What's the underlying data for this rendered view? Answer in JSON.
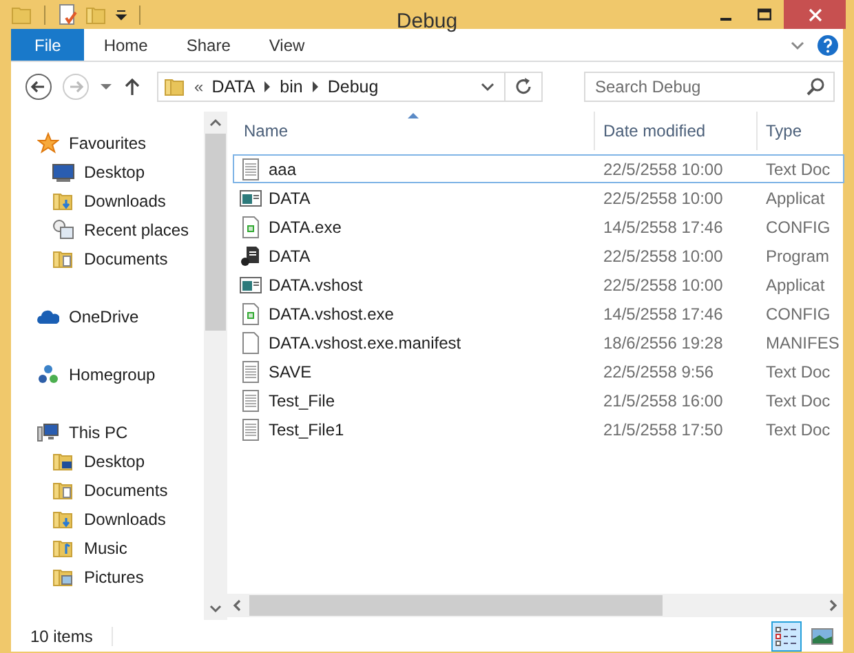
{
  "window": {
    "title": "Debug"
  },
  "ribbon_tabs": [
    {
      "label": "File",
      "kind": "file"
    },
    {
      "label": "Home",
      "kind": "tab"
    },
    {
      "label": "Share",
      "kind": "tab"
    },
    {
      "label": "View",
      "kind": "tab"
    }
  ],
  "address_bar": {
    "overflow": "«",
    "path": [
      "DATA",
      "bin",
      "Debug"
    ]
  },
  "search": {
    "placeholder": "Search Debug"
  },
  "navigation": [
    {
      "label": "Favourites",
      "kind": "star",
      "children": [
        {
          "label": "Desktop",
          "kind": "desktop"
        },
        {
          "label": "Downloads",
          "kind": "downloads"
        },
        {
          "label": "Recent places",
          "kind": "recent"
        },
        {
          "label": "Documents",
          "kind": "documents"
        }
      ]
    },
    {
      "label": "OneDrive",
      "kind": "cloud"
    },
    {
      "label": "Homegroup",
      "kind": "homegroup"
    },
    {
      "label": "This PC",
      "kind": "pc",
      "children": [
        {
          "label": "Desktop",
          "kind": "desktop-folder"
        },
        {
          "label": "Documents",
          "kind": "documents"
        },
        {
          "label": "Downloads",
          "kind": "downloads"
        },
        {
          "label": "Music",
          "kind": "music"
        },
        {
          "label": "Pictures",
          "kind": "pictures"
        }
      ]
    }
  ],
  "table": {
    "columns": [
      {
        "label": "Name",
        "sorted": true
      },
      {
        "label": "Date modified",
        "sorted": false
      },
      {
        "label": "Type",
        "sorted": false
      }
    ],
    "rows": [
      {
        "name": "aaa",
        "date": "22/5/2558 10:00",
        "type": "Text Doc",
        "kind": "text",
        "focused": true
      },
      {
        "name": "DATA",
        "date": "22/5/2558 10:00",
        "type": "Applicat",
        "kind": "app",
        "focused": false
      },
      {
        "name": "DATA.exe",
        "date": "14/5/2558 17:46",
        "type": "CONFIG",
        "kind": "config",
        "focused": false
      },
      {
        "name": "DATA",
        "date": "22/5/2558 10:00",
        "type": "Program",
        "kind": "program",
        "focused": false
      },
      {
        "name": "DATA.vshost",
        "date": "22/5/2558 10:00",
        "type": "Applicat",
        "kind": "app",
        "focused": false
      },
      {
        "name": "DATA.vshost.exe",
        "date": "14/5/2558 17:46",
        "type": "CONFIG",
        "kind": "config",
        "focused": false
      },
      {
        "name": "DATA.vshost.exe.manifest",
        "date": "18/6/2556 19:28",
        "type": "MANIFES",
        "kind": "blank",
        "focused": false
      },
      {
        "name": "SAVE",
        "date": "22/5/2558 9:56",
        "type": "Text Doc",
        "kind": "text",
        "focused": false
      },
      {
        "name": "Test_File",
        "date": "21/5/2558 16:00",
        "type": "Text Doc",
        "kind": "text",
        "focused": false
      },
      {
        "name": "Test_File1",
        "date": "21/5/2558 17:50",
        "type": "Text Doc",
        "kind": "text",
        "focused": false
      }
    ]
  },
  "status_bar": {
    "count": "10 items"
  },
  "view_buttons": [
    {
      "kind": "details",
      "selected": true
    },
    {
      "kind": "large-icons",
      "selected": false
    }
  ]
}
